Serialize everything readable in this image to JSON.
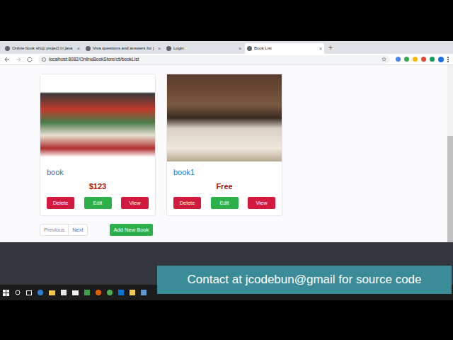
{
  "browser": {
    "tabs": [
      {
        "label": "Online book shop project in java",
        "selected": false
      },
      {
        "label": "Viva questions and answers for j",
        "selected": false
      },
      {
        "label": "Login",
        "selected": false
      },
      {
        "label": "Book List",
        "selected": true
      }
    ],
    "close_glyph": "×",
    "new_tab_glyph": "+",
    "address": "localhost:8082/OnlineBookStore/ctl/bookList"
  },
  "books": [
    {
      "title": "book",
      "price": "$123",
      "actions": [
        "Delete",
        "Edit",
        "View"
      ]
    },
    {
      "title": "book1",
      "price": "Free",
      "actions": [
        "Delete",
        "Edit",
        "View"
      ]
    }
  ],
  "pagination": [
    {
      "label": "Previous",
      "disabled": true
    },
    {
      "label": "Next",
      "disabled": false
    }
  ],
  "add_button": "Add New Book",
  "banner": "Contact at jcodebun@gmail for source code"
}
